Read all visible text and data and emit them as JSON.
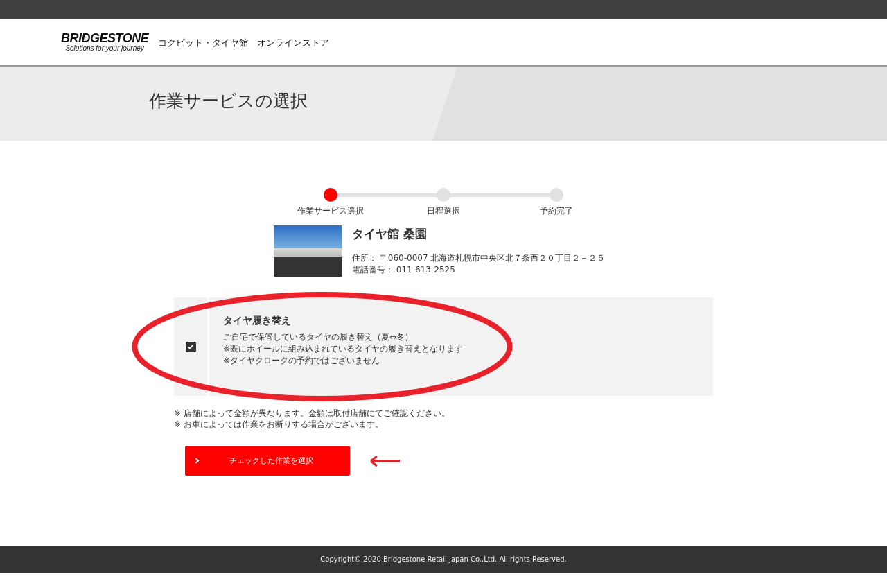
{
  "header": {
    "logo": "BRIDGESTONE",
    "tagline": "Solutions for your journey",
    "site_title": "コクピット・タイヤ館　オンラインストア"
  },
  "page_title": "作業サービスの選択",
  "steps": [
    {
      "label": "作業サービス選択",
      "selected": true
    },
    {
      "label": "日程選択",
      "selected": false
    },
    {
      "label": "予約完了",
      "selected": false
    }
  ],
  "store": {
    "name": "タイヤ館 桑園",
    "address": "住所： 〒060-0007 北海道札幌市中央区北７条西２０丁目２－２５",
    "phone": "電話番号： 011-613-2525"
  },
  "options": [
    {
      "title": "タイヤ履き替え",
      "checked": true,
      "lines": [
        "ご自宅で保管しているタイヤの履き替え（夏⇔冬）",
        "※既にホイールに組み込まれているタイヤの履き替えとなります",
        "※タイヤクロークの予約ではございません"
      ]
    }
  ],
  "notes": [
    "※ 店舗によって金額が異なります。金額は取付店舗にてご確認ください。",
    "※ お車によっては作業をお断りする場合がございます。"
  ],
  "submit_button": "チェックした作業を選択",
  "footer": "Copyright© 2020 Bridgestone Retail Japan Co.,Ltd. All rights Reserved."
}
